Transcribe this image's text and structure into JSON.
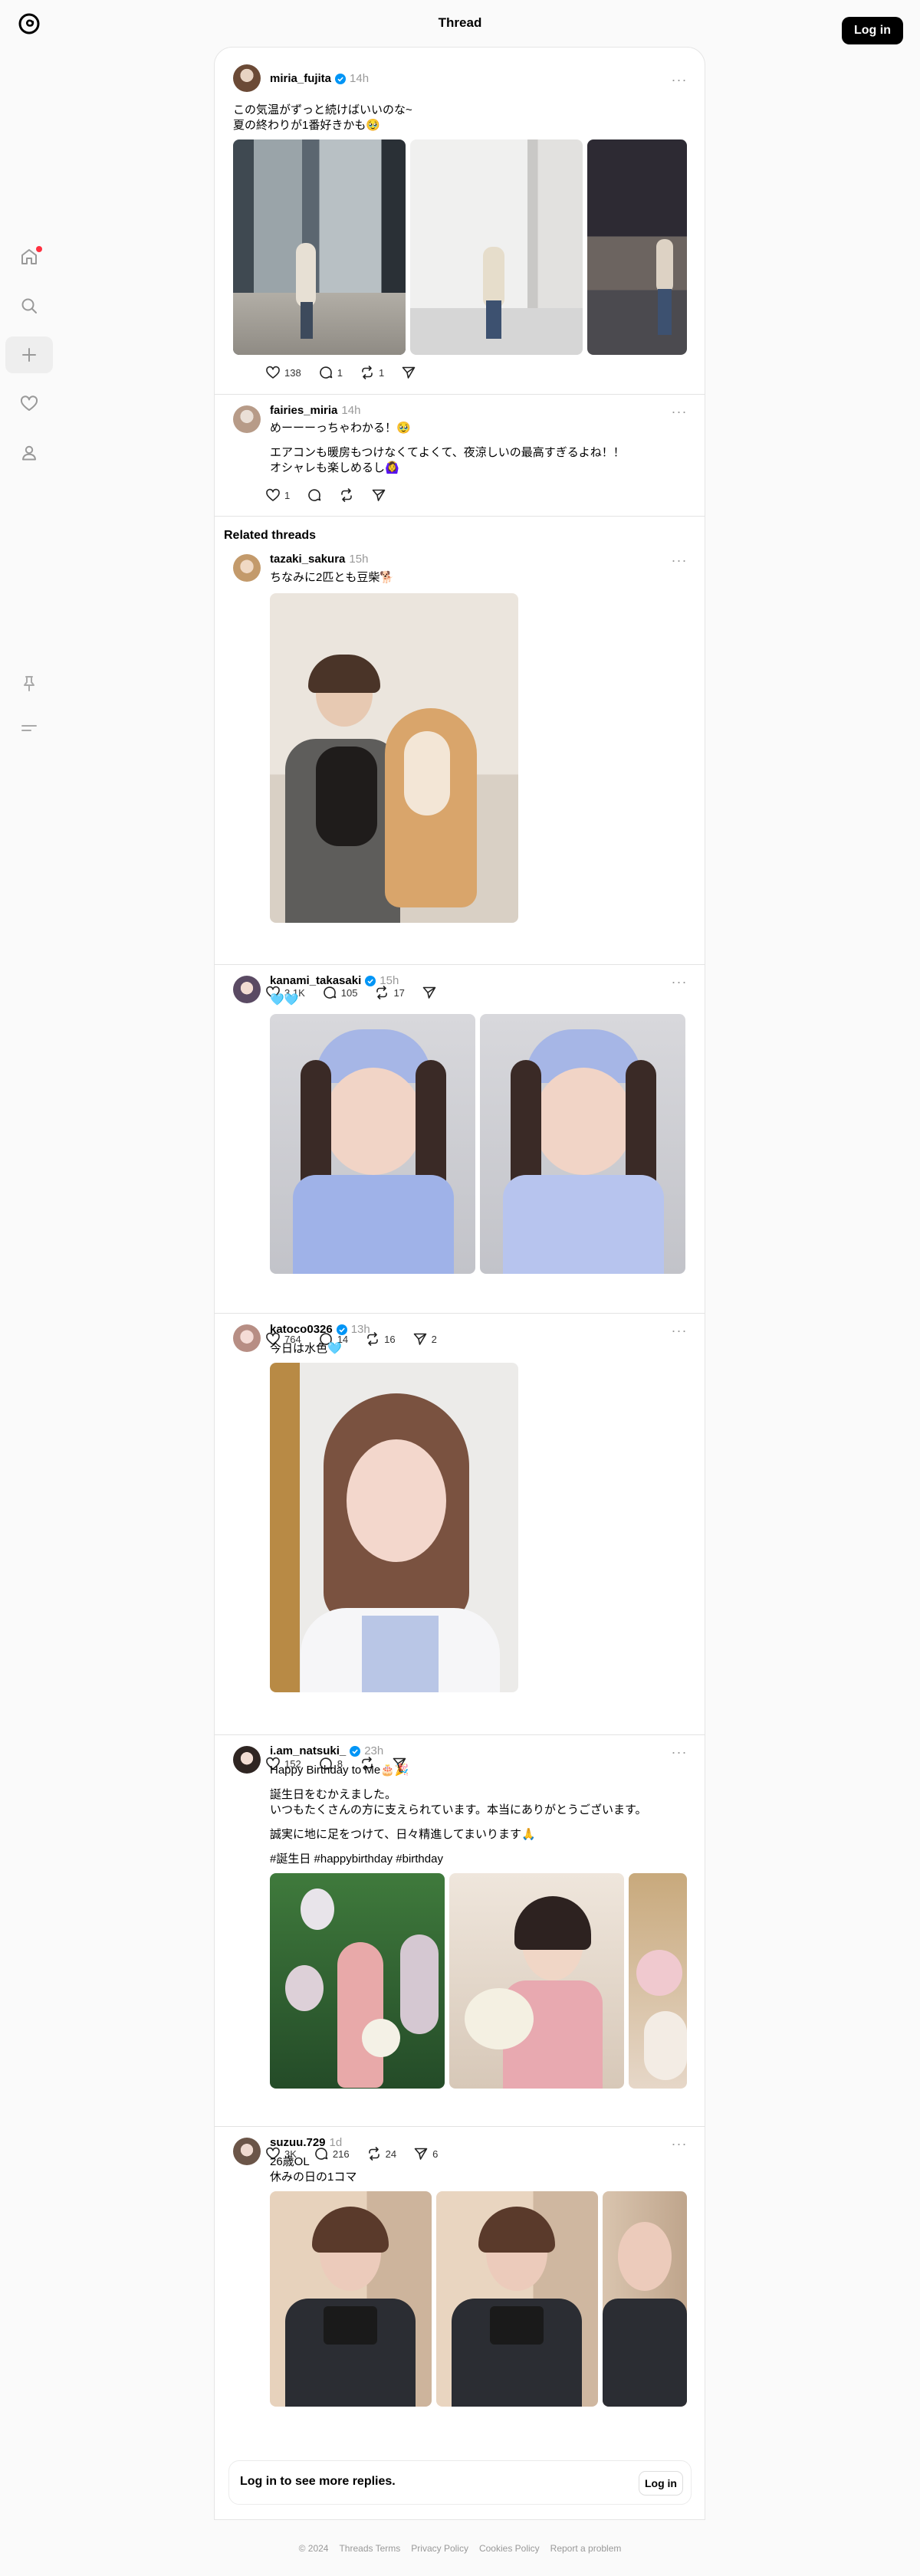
{
  "header": {
    "title": "Thread",
    "login_label": "Log in"
  },
  "nav": {
    "icons": [
      "home-icon",
      "search-icon",
      "create-icon",
      "heart-icon",
      "profile-icon",
      "pin-icon",
      "menu-icon"
    ]
  },
  "main_post": {
    "username": "miria_fujita",
    "time": "14h",
    "text": "この気温がずっと続けばいいのな~\n夏の終わりが1番好きかも🥹",
    "likes": "138",
    "replies": "1",
    "reposts": "1"
  },
  "reply": {
    "username": "fairies_miria",
    "time": "14h",
    "line1": "めーーーっちゃわかる！🥹",
    "text": "エアコンも暖房もつけなくてよくて、夜涼しいの最高すぎるよね！！\nオシャレも楽しめるし🙆‍♀️",
    "likes": "1"
  },
  "related_title": "Related threads",
  "related": [
    {
      "username": "tazaki_sakura",
      "time": "15h",
      "text": "ちなみに2匹とも豆柴🐕",
      "likes": "3.1K",
      "replies": "105",
      "reposts": "17",
      "shares": ""
    },
    {
      "username": "kanami_takasaki",
      "time": "15h",
      "text": "🩵🩵",
      "likes": "764",
      "replies": "14",
      "reposts": "16",
      "shares": "2"
    },
    {
      "username": "katoco0326",
      "time": "13h",
      "text": "今日は水色🩵",
      "likes": "152",
      "replies": "8",
      "reposts": "",
      "shares": ""
    },
    {
      "username": "i.am_natsuki_",
      "time": "23h",
      "text": "Happy Birthday to Me🎂🎉",
      "text2": "誕生日をむかえました。\nいつもたくさんの方に支えられています。本当にありがとうございます。",
      "text3": "誠実に地に足をつけて、日々精進してまいります🙏",
      "text4": "#誕生日 #happybirthday #birthday",
      "likes": "3K",
      "replies": "216",
      "reposts": "24",
      "shares": "6"
    },
    {
      "username": "suzuu.729",
      "time": "1d",
      "text": "26歳OL\n休みの日の1コマ",
      "likes": "632",
      "replies": "28",
      "reposts": "1",
      "shares": ""
    }
  ],
  "login_prompt": {
    "text": "Log in to see more replies.",
    "button": "Log in"
  },
  "footer": [
    "© 2024",
    "Threads Terms",
    "Privacy Policy",
    "Cookies Policy",
    "Report a problem"
  ],
  "colors": {
    "verified": "#0095f6",
    "notification": "#ff3040"
  }
}
